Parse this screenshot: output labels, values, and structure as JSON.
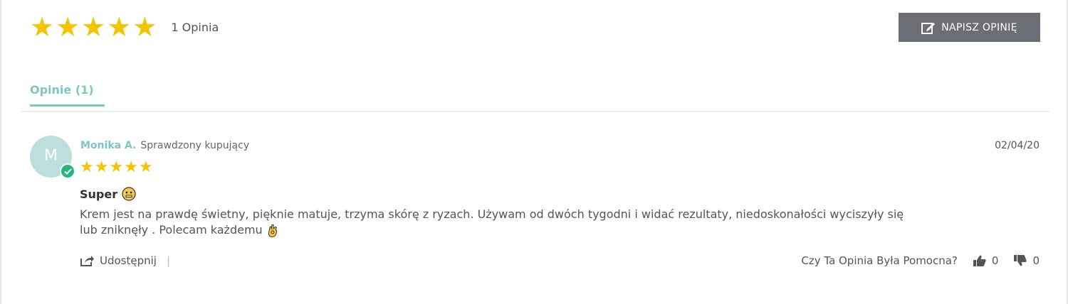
{
  "summary": {
    "rating": 5,
    "count_label": "1 Opinia"
  },
  "write_button": {
    "label": "NAPISZ OPINIĘ"
  },
  "tabs": [
    {
      "label": "Opinie (1)",
      "active": true
    }
  ],
  "review": {
    "avatar_initial": "M",
    "author": "Monika A.",
    "badge": "Sprawdzony kupujący",
    "date": "02/04/20",
    "rating": 5,
    "title": "Super",
    "body_line1": "Krem jest na prawdę świetny, pięknie matuje, trzyma skórę z ryzach. Używam od dwóch tygodni i widać rezultaty, niedoskonałości wyciszyły się",
    "body_line2": "lub zniknęły . Polecam każdemu",
    "share_label": "Udostępnij",
    "separator": "|",
    "helpful_question": "Czy Ta Opinia Była Pomocna?",
    "thumbs_up_count": "0",
    "thumbs_down_count": "0"
  },
  "colors": {
    "accent": "#7ec7c0",
    "star": "#f4c400",
    "button": "#6b6e74",
    "verified": "#27b67c"
  }
}
